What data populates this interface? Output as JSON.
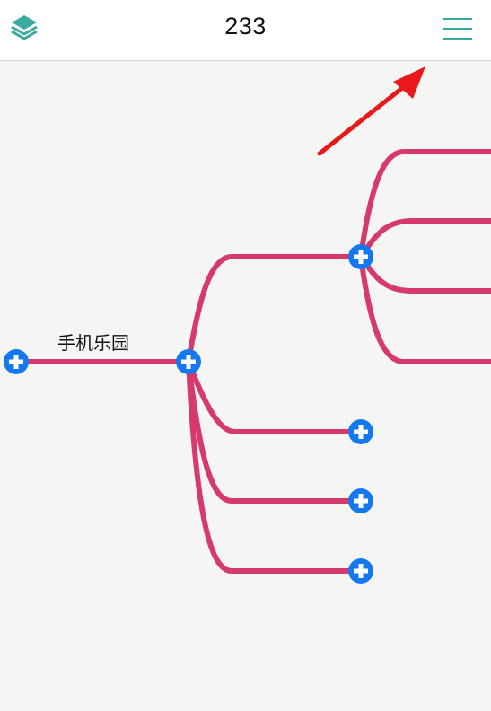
{
  "header": {
    "title": "233",
    "layers_icon": "layers-icon",
    "menu_icon": "hamburger-menu-icon"
  },
  "mindmap": {
    "root_label": "手机乐园",
    "branch_color": "#d63a6c",
    "expand_button_color": "#1479f0"
  },
  "annotation": {
    "arrow_color": "#e8191b"
  },
  "colors": {
    "accent": "#3aa99f",
    "header_bg": "#ffffff",
    "canvas_bg": "#f5f6f4"
  }
}
